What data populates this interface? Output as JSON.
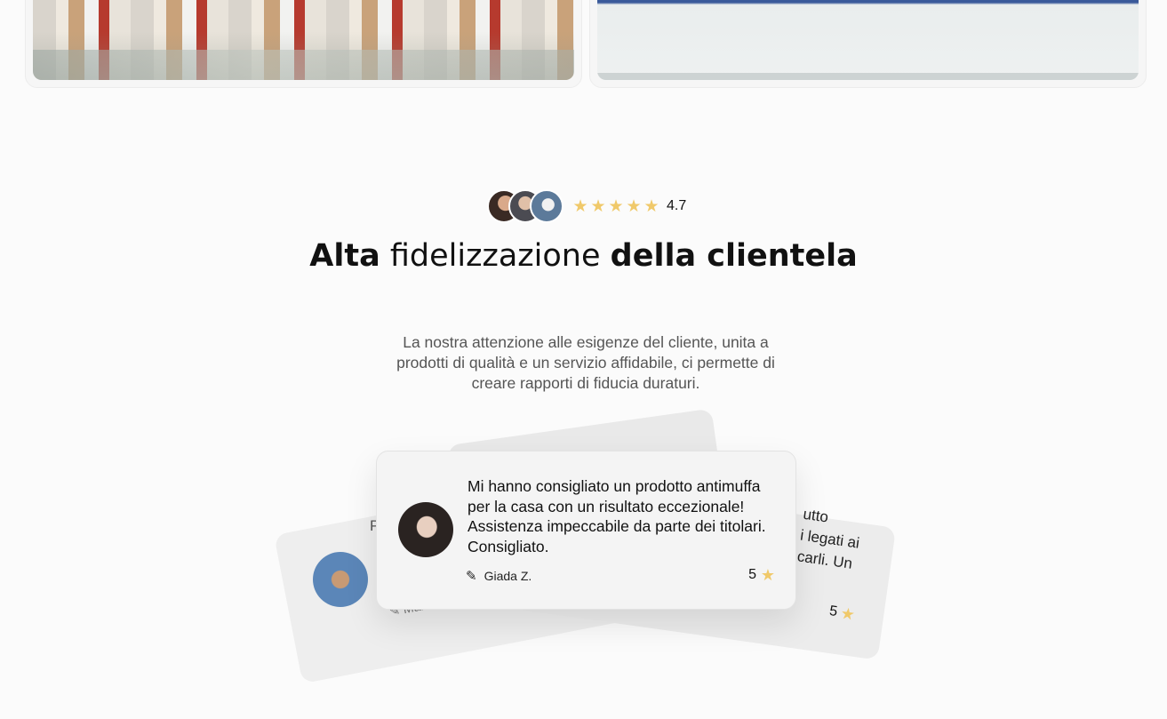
{
  "hero": {
    "rating_value": "4.7",
    "stars": [
      "★",
      "★",
      "★",
      "★",
      "★"
    ],
    "title_bold_1": "Alta",
    "title_regular": "fidelizzazione",
    "title_bold_2": "della clientela",
    "subtitle": "La nostra attenzione alle esigenze del cliente, unita a prodotti di qualità e un servizio affidabile, ci permette di creare rapporti di fiducia duraturi."
  },
  "reviews": {
    "main": {
      "text": "Mi hanno consigliato un prodotto antimuffa per la casa con un risultato eccezionale! Assistenza impeccabile da parte dei titolari. Consigliato.",
      "author": "Giada Z.",
      "score": "5",
      "pen_icon": "✎",
      "star_icon": "★"
    },
    "right_fragment": {
      "text": "utto\ni legati ai\ncarli. Un",
      "score": "5",
      "star_icon": "★"
    },
    "left_fragment": {
      "letter": "P",
      "author": "✎ Marc"
    }
  },
  "colors": {
    "star": "#f0c96a",
    "background": "#fbfbfb",
    "card": "#f4f4f4"
  }
}
